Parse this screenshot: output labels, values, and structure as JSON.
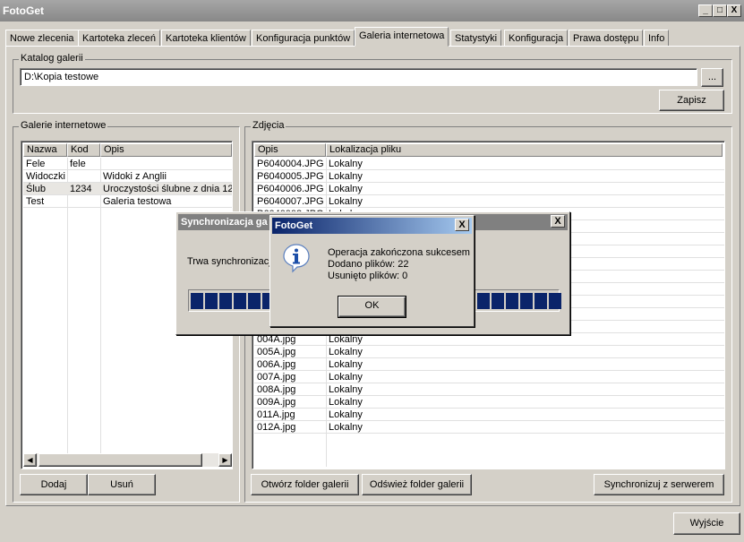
{
  "window": {
    "title": "FotoGet",
    "minimize": "_",
    "maximize": "□",
    "close": "X"
  },
  "tabs": [
    "Nowe zlecenia",
    "Kartoteka zleceń",
    "Kartoteka klientów",
    "Konfiguracja punktów",
    "Galeria internetowa",
    "Statystyki",
    "Konfiguracja",
    "Prawa dostępu",
    "Info"
  ],
  "catalog": {
    "label": "Katalog galerii",
    "path": "D:\\Kopia testowe",
    "browse": "...",
    "save": "Zapisz"
  },
  "galleries": {
    "label": "Galerie internetowe",
    "columns": [
      "Nazwa",
      "Kod",
      "Opis"
    ],
    "rows": [
      [
        "Fele",
        "fele",
        ""
      ],
      [
        "Widoczki",
        "",
        "Widoki z Anglii"
      ],
      [
        "Ślub",
        "1234",
        "Uroczystości ślubne z dnia 12."
      ],
      [
        "Test",
        "",
        "Galeria testowa"
      ]
    ],
    "add": "Dodaj",
    "remove": "Usuń"
  },
  "photos": {
    "label": "Zdjęcia",
    "columns": [
      "Opis",
      "Lokalizacja pliku"
    ],
    "rows_top": [
      [
        "P6040004.JPG",
        "Lokalny"
      ],
      [
        "P6040005.JPG",
        "Lokalny"
      ],
      [
        "P6040006.JPG",
        "Lokalny"
      ],
      [
        "P6040007.JPG",
        "Lokalny"
      ],
      [
        "P6040008.JPG",
        "Lokalny"
      ]
    ],
    "rows_bottom": [
      [
        "004A.jpg",
        "Lokalny"
      ],
      [
        "005A.jpg",
        "Lokalny"
      ],
      [
        "006A.jpg",
        "Lokalny"
      ],
      [
        "007A.jpg",
        "Lokalny"
      ],
      [
        "008A.jpg",
        "Lokalny"
      ],
      [
        "009A.jpg",
        "Lokalny"
      ],
      [
        "011A.jpg",
        "Lokalny"
      ],
      [
        "012A.jpg",
        "Lokalny"
      ]
    ],
    "open_folder": "Otwórz folder galerii",
    "refresh_folder": "Odśwież folder galerii",
    "sync": "Synchronizuj z serwerem"
  },
  "exit": "Wyjście",
  "sync_dialog": {
    "title": "Synchronizacja ga",
    "text": "Trwa synchronizacj",
    "close": "X",
    "progress": 1.0
  },
  "message": {
    "title": "FotoGet",
    "close": "X",
    "icon": "info-icon",
    "line1": "Operacja zakończona sukcesem",
    "line2": "Dodano plików: 22",
    "line3": "Usunięto plików: 0",
    "ok": "OK"
  }
}
